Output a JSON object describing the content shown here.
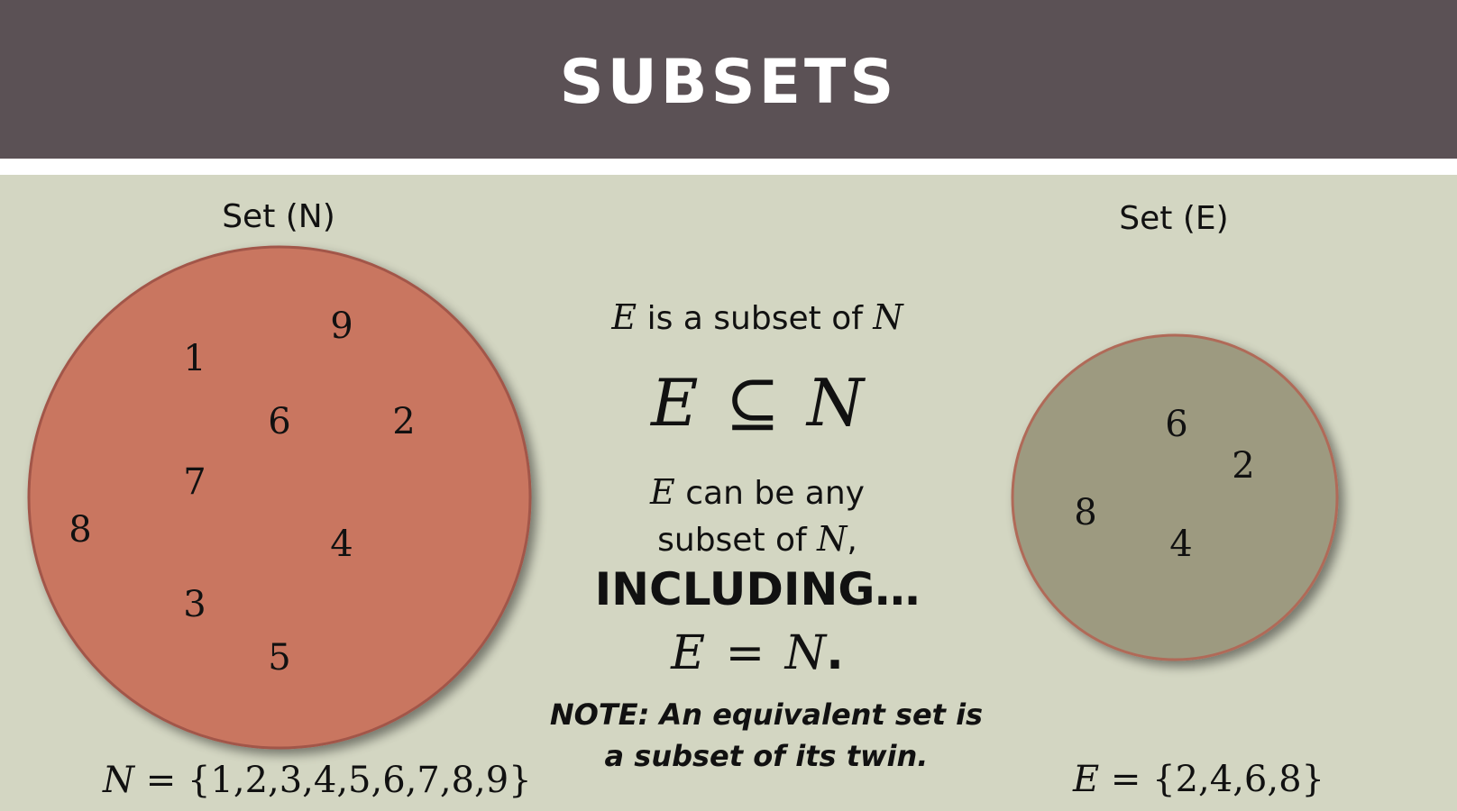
{
  "header": {
    "title": "SUBSETS"
  },
  "set_n": {
    "label": "Set (N)",
    "elements": [
      "9",
      "1",
      "6",
      "2",
      "7",
      "8",
      "4",
      "3",
      "5"
    ],
    "definition_var": "N",
    "definition_eq": "=",
    "definition_set": "{1,2,3,4,5,6,7,8,9}",
    "fill": "#c97660",
    "stroke": "#a2564a"
  },
  "set_e": {
    "label": "Set (E)",
    "elements": [
      "6",
      "2",
      "8",
      "4"
    ],
    "definition_var": "E",
    "definition_eq": "=",
    "definition_set": "{2,4,6,8}",
    "fill": "#9d9a80",
    "stroke": "#b06a58"
  },
  "middle": {
    "line1_var": "E",
    "line1_text": " is a subset of ",
    "line1_var2": "N",
    "symbol_left": "E",
    "symbol_op": "⊆",
    "symbol_right": "N",
    "line3_var": "E",
    "line3_text": " can be any",
    "line4_text": "subset of ",
    "line4_var": "N",
    "line4_punct": ",",
    "including": "INCLUDING…",
    "eq_left": "E",
    "eq_op": "=",
    "eq_right": "N",
    "eq_punct": ".",
    "note_line1": "NOTE: An equivalent set is",
    "note_line2": "a subset of its twin."
  }
}
